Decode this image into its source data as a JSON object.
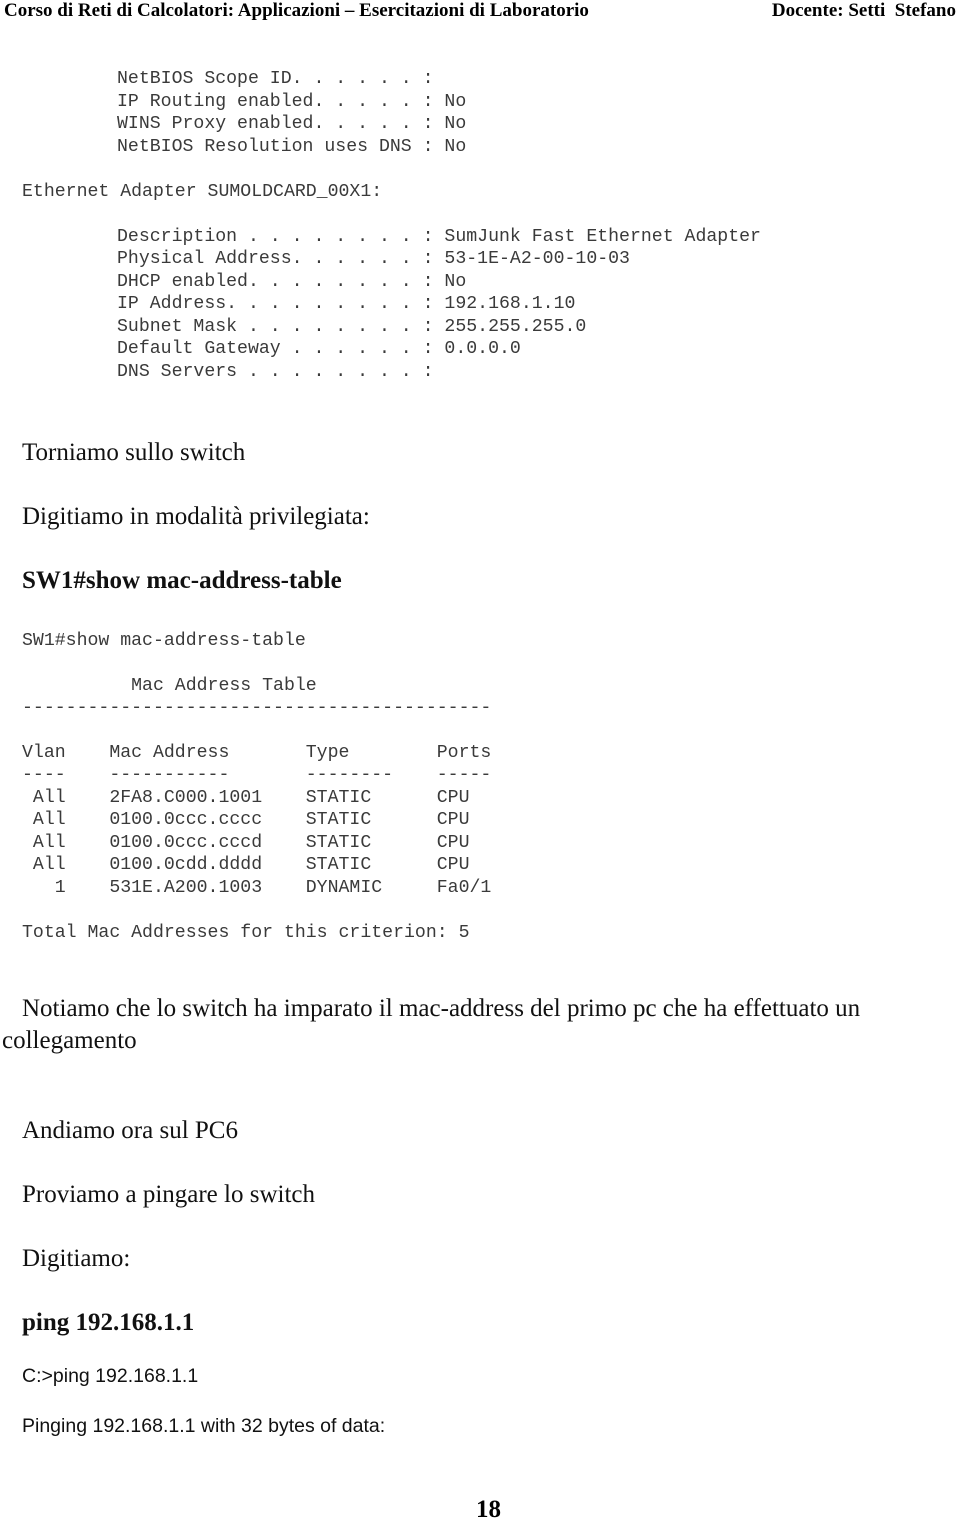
{
  "header": {
    "left": "Corso di Reti di Calcolatori: Applicazioni – Esercitazioni di Laboratorio",
    "right": "Docente: Setti  Stefano"
  },
  "ipconfig_top": [
    "NetBIOS Scope ID. . . . . . :",
    "IP Routing enabled. . . . . : No",
    "WINS Proxy enabled. . . . . : No",
    "NetBIOS Resolution uses DNS : No"
  ],
  "adapter_title": "Ethernet Adapter SUMOLDCARD_00X1:",
  "adapter_lines": [
    "Description . . . . . . . . : SumJunk Fast Ethernet Adapter",
    "Physical Address. . . . . . : 53-1E-A2-00-10-03",
    "DHCP enabled. . . . . . . . : No",
    "IP Address. . . . . . . . . : 192.168.1.10",
    "Subnet Mask . . . . . . . . : 255.255.255.0",
    "Default Gateway . . . . . . : 0.0.0.0",
    "DNS Servers . . . . . . . . :"
  ],
  "text1": "Torniamo sullo switch",
  "text2": "Digitiamo in modalità privilegiata:",
  "command1": "SW1#show mac-address-table",
  "switch_output": {
    "prompt": "SW1#show mac-address-table",
    "title": "          Mac Address Table",
    "rule": "-------------------------------------------",
    "header": "Vlan    Mac Address       Type        Ports",
    "underline": "----    -----------       --------    -----",
    "rows": [
      " All    2FA8.C000.1001    STATIC      CPU",
      " All    0100.0ccc.cccc    STATIC      CPU",
      " All    0100.0ccc.cccd    STATIC      CPU",
      " All    0100.0cdd.dddd    STATIC      CPU",
      "   1    531E.A200.1003    DYNAMIC     Fa0/1"
    ],
    "total": "Total Mac Addresses for this criterion: 5"
  },
  "note_line1": "Notiamo che lo switch ha imparato il mac-address del primo pc che ha effettuato un",
  "note_line2": "collegamento",
  "text3": "Andiamo ora sul PC6",
  "text4": "Proviamo a pingare lo switch",
  "text5": "Digitiamo:",
  "command2": "ping 192.168.1.1",
  "ping_cmd": "C:>ping 192.168.1.1",
  "ping_output": "Pinging 192.168.1.1 with 32 bytes of data:",
  "page_number": "18"
}
